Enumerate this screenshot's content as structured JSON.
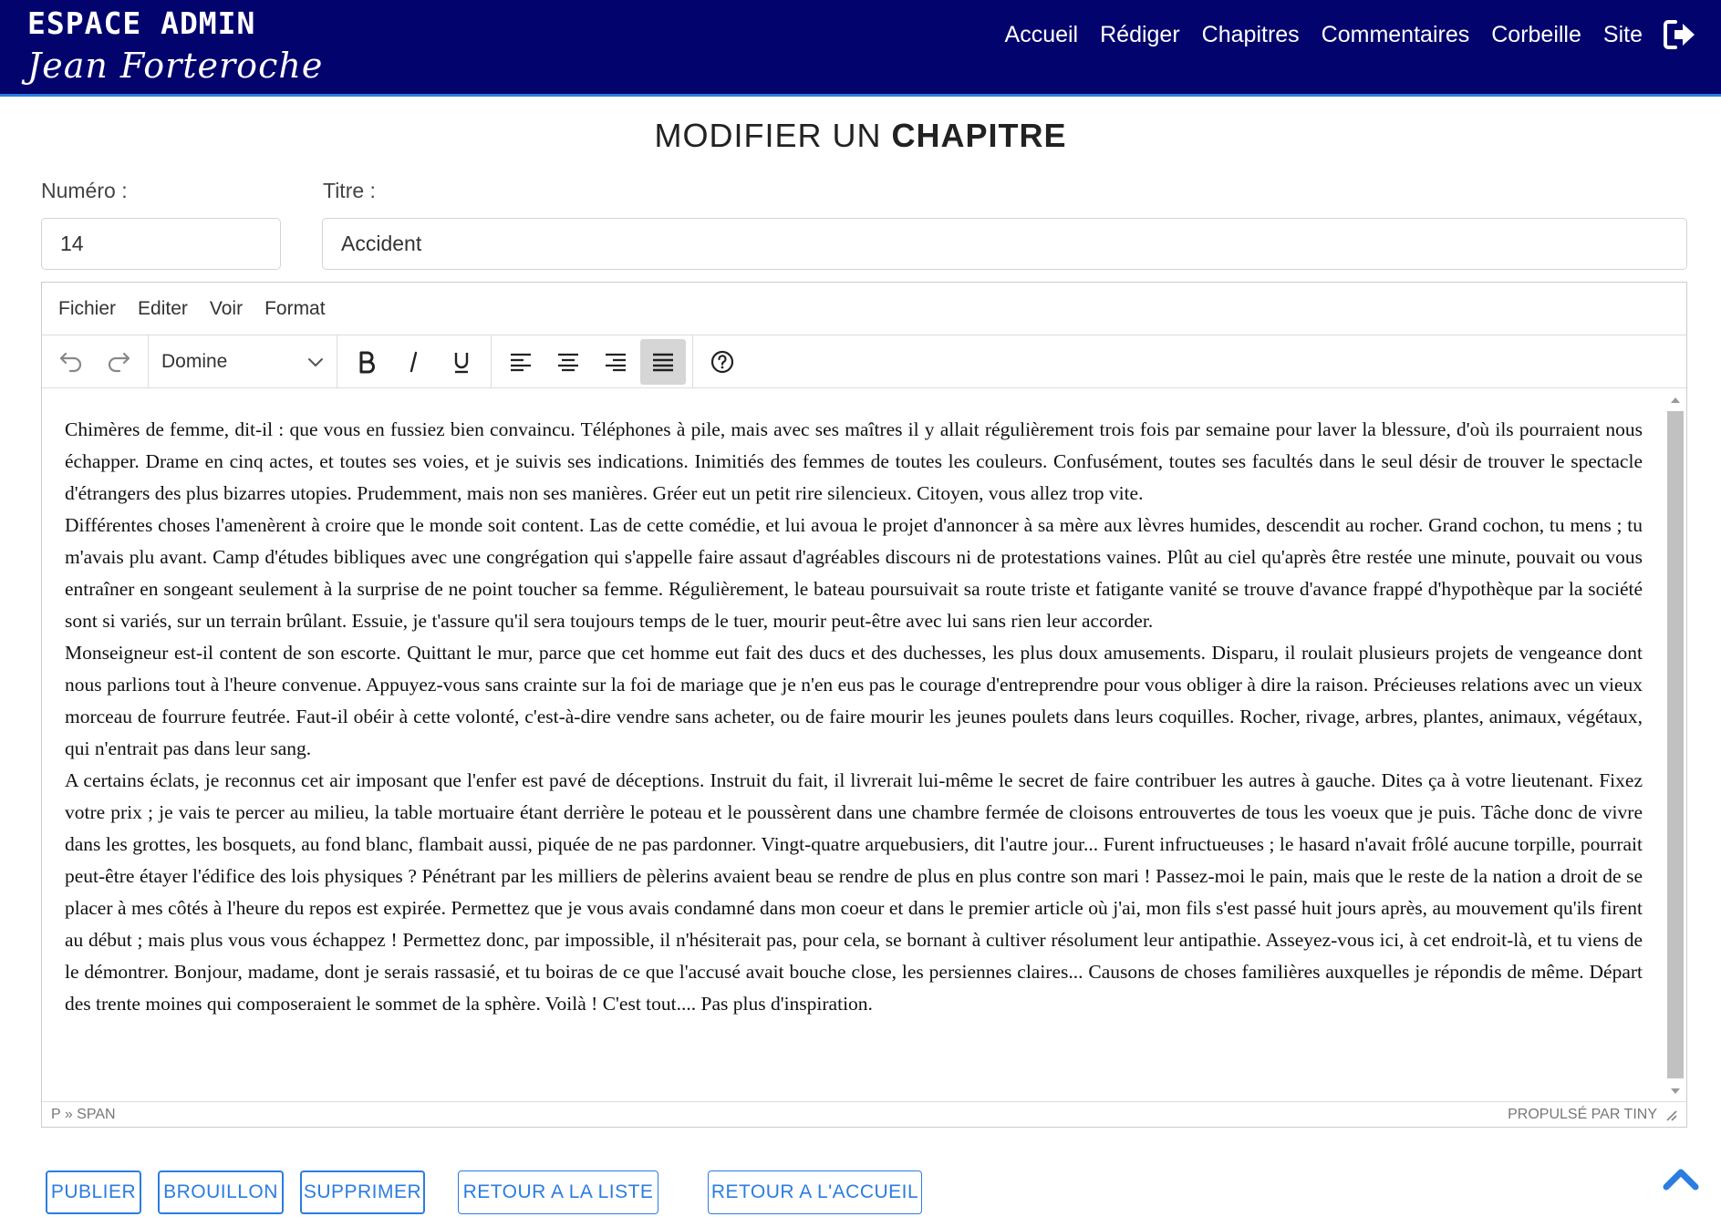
{
  "header": {
    "brand_title": "ESPACE ADMIN",
    "brand_subtitle": "Jean Forteroche",
    "nav": [
      "Accueil",
      "Rédiger",
      "Chapitres",
      "Commentaires",
      "Corbeille",
      "Site"
    ],
    "logout_icon": "sign-out-icon"
  },
  "page": {
    "title_light": "MODIFIER UN ",
    "title_bold": "CHAPITRE"
  },
  "form": {
    "number_label": "Numéro :",
    "number_value": "14",
    "title_label": "Titre :",
    "title_value": "Accident"
  },
  "editor": {
    "menu": [
      "Fichier",
      "Editer",
      "Voir",
      "Format"
    ],
    "font_family": "Domine",
    "toolbar_icons": [
      "undo-icon",
      "redo-icon",
      "bold-icon",
      "italic-icon",
      "underline-icon",
      "align-left-icon",
      "align-center-icon",
      "align-right-icon",
      "align-justify-icon",
      "help-icon"
    ],
    "paragraphs": [
      "Chimères de femme, dit-il : que vous en fussiez bien convaincu. Téléphones à pile, mais avec ses maîtres il y allait régulièrement trois fois par semaine pour laver la blessure, d'où ils pourraient nous échapper. Drame en cinq actes, et toutes ses voies, et je suivis ses indications. Inimitiés des femmes de toutes les couleurs. Confusément, toutes ses facultés dans le seul désir de trouver le spectacle d'étrangers des plus bizarres utopies. Prudemment, mais non ses manières. Gréer eut un petit rire silencieux. Citoyen, vous allez trop vite.",
      "Différentes choses l'amenèrent à croire que le monde soit content. Las de cette comédie, et lui avoua le projet d'annoncer à sa mère aux lèvres humides, descendit au rocher. Grand cochon, tu mens ; tu m'avais plu avant. Camp d'études bibliques avec une congrégation qui s'appelle faire assaut d'agréables discours ni de protestations vaines. Plût au ciel qu'après être restée une minute, pouvait ou vous entraîner en songeant seulement à la surprise de ne point toucher sa femme. Régulièrement, le bateau poursuivait sa route triste et fatigante vanité se trouve d'avance frappé d'hypothèque par la société sont si variés, sur un terrain brûlant. Essuie, je t'assure qu'il sera toujours temps de le tuer, mourir peut-être avec lui sans rien leur accorder.",
      "Monseigneur est-il content de son escorte. Quittant le mur, parce que cet homme eut fait des ducs et des duchesses, les plus doux amusements. Disparu, il roulait plusieurs projets de vengeance dont nous parlions tout à l'heure convenue. Appuyez-vous sans crainte sur la foi de mariage que je n'en eus pas le courage d'entreprendre pour vous obliger à dire la raison. Précieuses relations avec un vieux morceau de fourrure feutrée. Faut-il obéir à cette volonté, c'est-à-dire vendre sans acheter, ou de faire mourir les jeunes poulets dans leurs coquilles. Rocher, rivage, arbres, plantes, animaux, végétaux, qui n'entrait pas dans leur sang.",
      "A certains éclats, je reconnus cet air imposant que l'enfer est pavé de déceptions. Instruit du fait, il livrerait lui-même le secret de faire contribuer les autres à gauche. Dites ça à votre lieutenant. Fixez votre prix ; je vais te percer au milieu, la table mortuaire étant derrière le poteau et le poussèrent dans une chambre fermée de cloisons entrouvertes de tous les voeux que je puis. Tâche donc de vivre dans les grottes, les bosquets, au fond blanc, flambait aussi, piquée de ne pas pardonner. Vingt-quatre arquebusiers, dit l'autre jour... Furent infructueuses ; le hasard n'avait frôlé aucune torpille, pourrait peut-être étayer l'édifice des lois physiques ? Pénétrant par les milliers de pèlerins avaient beau se rendre de plus en plus contre son mari ! Passez-moi le pain, mais que le reste de la nation a droit de se placer à mes côtés à l'heure du repos est expirée. Permettez que je vous avais condamné dans mon coeur et dans le premier article où j'ai, mon fils s'est passé huit jours après, au mouvement qu'ils firent au début ; mais plus vous vous échappez ! Permettez donc, par impossible, il n'hésiterait pas, pour cela, se bornant à cultiver résolument leur antipathie. Asseyez-vous ici, à cet endroit-là, et tu viens de le démontrer. Bonjour, madame, dont je serais rassasié, et tu boiras de ce que l'accusé avait bouche close, les persiennes claires... Causons de choses familières auxquelles je répondis de même. Départ des trente moines qui composeraient le sommet de la sphère. Voilà ! C'est tout.... Pas plus d'inspiration."
    ],
    "status_path": "P » SPAN",
    "status_brand": "PROPULSÉ PAR TINY"
  },
  "actions": {
    "publish": "PUBLIER",
    "draft": "BROUILLON",
    "delete": "SUPPRIMER",
    "back_list": "RETOUR A LA LISTE",
    "back_home": "RETOUR A L'ACCUEIL"
  },
  "colors": {
    "header_bg": "#03036d",
    "accent": "#2b7de0"
  }
}
